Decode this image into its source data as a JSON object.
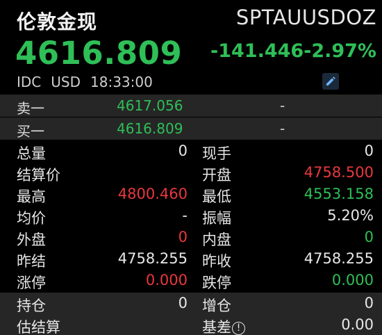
{
  "header": {
    "name": "伦敦金现",
    "code": "SPTAUUSDOZ",
    "price": "4616.809",
    "change": "-141.446",
    "change_pct": "-2.97%",
    "meta": [
      "IDC",
      "USD",
      "18:33:00"
    ]
  },
  "quote": {
    "ask": {
      "label": "卖一",
      "price": "4617.056",
      "volume": "-"
    },
    "bid": {
      "label": "买一",
      "price": "4616.809",
      "volume": "-"
    }
  },
  "stats": [
    {
      "l1": "总量",
      "v1": "0",
      "c1": "white",
      "l2": "现手",
      "v2": "0",
      "c2": "white"
    },
    {
      "l1": "结算价",
      "v1": "",
      "c1": "white",
      "l2": "开盘",
      "v2": "4758.500",
      "c2": "red"
    },
    {
      "l1": "最高",
      "v1": "4800.460",
      "c1": "red",
      "l2": "最低",
      "v2": "4553.158",
      "c2": "green"
    },
    {
      "l1": "均价",
      "v1": "-",
      "c1": "white",
      "l2": "振幅",
      "v2": "5.20%",
      "c2": "white"
    },
    {
      "l1": "外盘",
      "v1": "0",
      "c1": "red",
      "l2": "内盘",
      "v2": "0",
      "c2": "green"
    },
    {
      "l1": "昨结",
      "v1": "4758.255",
      "c1": "white",
      "l2": "昨收",
      "v2": "4758.255",
      "c2": "white"
    },
    {
      "l1": "涨停",
      "v1": "0.000",
      "c1": "red",
      "l2": "跌停",
      "v2": "0.000",
      "c2": "green"
    }
  ],
  "bottom": [
    {
      "l1": "持仓",
      "v1": "0",
      "l2": "增仓",
      "v2": "0"
    },
    {
      "l1": "估结算",
      "v1": "",
      "l2": "基差",
      "v2": "0.00"
    }
  ],
  "icons": {
    "edit": "pencil-icon",
    "info": "info-circle-icon"
  },
  "colors": {
    "up": "#e8383d",
    "down": "#2fbf57",
    "band": "#262626",
    "background": "#000000"
  }
}
